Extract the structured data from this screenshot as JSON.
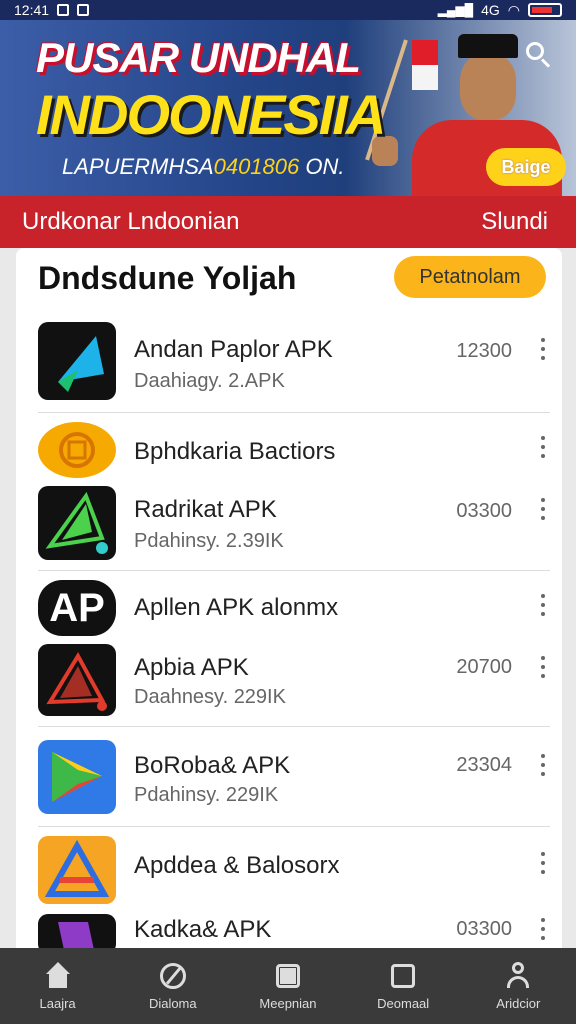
{
  "status_bar": {
    "time": "12:41",
    "network": "4G"
  },
  "banner": {
    "title_line1": "PUSAR UNDHAL",
    "title_line2": "INDOONESIIA",
    "subtitle_prefix": "LAPUERMHSA",
    "subtitle_highlight": "0401806",
    "subtitle_suffix": "ON.",
    "badge_label": "Baige"
  },
  "nav_bar": {
    "title": "Urdkonar Lndoonian",
    "right_label": "Slundi"
  },
  "section": {
    "title": "Dndsdune Yoljah",
    "action_label": "Petatnolam"
  },
  "apps": [
    {
      "name": "Andan Paplor APK",
      "meta": "Daahiagy. 2.APK",
      "count": "12300"
    },
    {
      "name": "Bphdkaria Bactiors",
      "meta": "",
      "count": ""
    },
    {
      "name": "Radrikat APK",
      "meta": "Pdahinsy. 2.39IK",
      "count": "03300"
    },
    {
      "name": "Apllen APK alonmx",
      "meta": "",
      "count": ""
    },
    {
      "name": "Apbia APK",
      "meta": "Daahnesy. 229IK",
      "count": "20700"
    },
    {
      "name": "BoRoba& APK",
      "meta": "Pdahinsy. 229IK",
      "count": "23304"
    },
    {
      "name": "Apddea & Balosorx",
      "meta": "",
      "count": ""
    },
    {
      "name": "Kadka& APK",
      "meta": "",
      "count": "03300"
    }
  ],
  "app_icon_text": {
    "ap": "AP"
  },
  "bottom_nav": [
    {
      "label": "Laajra",
      "icon": "home-icon"
    },
    {
      "label": "Dialoma",
      "icon": "compass-icon"
    },
    {
      "label": "Meepnian",
      "icon": "edit-icon"
    },
    {
      "label": "Deomaal",
      "icon": "inbox-icon"
    },
    {
      "label": "Aridcior",
      "icon": "profile-icon"
    }
  ],
  "colors": {
    "accent_red": "#c8232b",
    "accent_yellow": "#fbb51b",
    "banner_blue": "#234487"
  }
}
